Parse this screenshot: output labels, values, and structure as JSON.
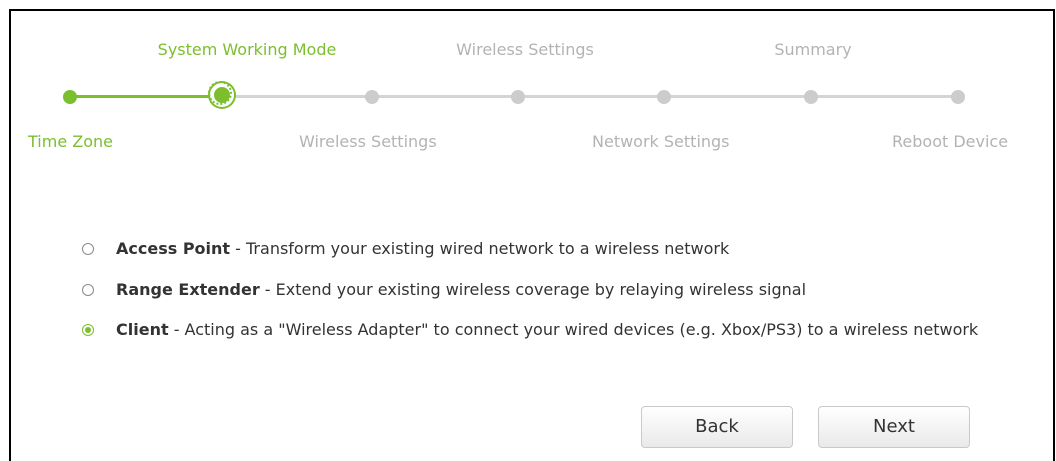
{
  "wizard": {
    "top_steps": [
      {
        "label": "System Working Mode",
        "state": "active"
      },
      {
        "label": "Wireless Settings",
        "state": "inactive"
      },
      {
        "label": "Summary",
        "state": "inactive"
      }
    ],
    "bottom_steps": [
      {
        "label": "Time Zone",
        "state": "active"
      },
      {
        "label": "Wireless Settings",
        "state": "inactive"
      },
      {
        "label": "Network Settings",
        "state": "inactive"
      },
      {
        "label": "Reboot Device",
        "state": "inactive"
      }
    ],
    "colors": {
      "accent": "#7bbf2e",
      "inactive_text": "#b3b3b3",
      "inactive_track": "#d4d4d4"
    }
  },
  "modes": [
    {
      "name": "Access Point",
      "description": " - Transform your existing wired network to a wireless network",
      "selected": false
    },
    {
      "name": "Range Extender",
      "description": " - Extend your existing wireless coverage by relaying wireless signal",
      "selected": false
    },
    {
      "name": "Client",
      "description": " - Acting as a \"Wireless Adapter\" to connect your wired devices (e.g. Xbox/PS3) to a wireless network",
      "selected": true
    }
  ],
  "buttons": {
    "back_label": "Back",
    "next_label": "Next"
  }
}
